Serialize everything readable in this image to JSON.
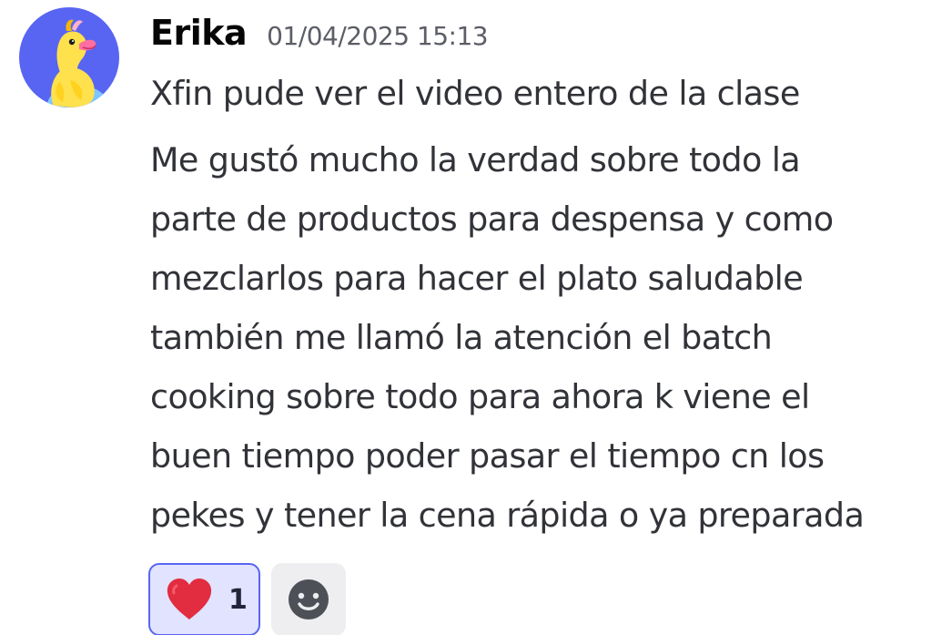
{
  "message": {
    "author": "Erika",
    "timestamp": "01/04/2025 15:13",
    "first_line": "Xfin pude ver el video entero de la clase",
    "body_lines": [
      "Me gustó mucho la verdad sobre todo la",
      "parte de productos para despensa y como",
      "mezclarlos para hacer el plato saludable",
      "también me llamó la atención el batch",
      "cooking sobre todo para ahora k viene el",
      "buen tiempo poder pasar el tiempo cn los",
      "pekes y tener la cena rápida o ya preparada"
    ]
  },
  "avatar": {
    "icon": "yellow-duck-avatar-icon",
    "background": "#5865f2"
  },
  "reactions": [
    {
      "emoji_icon": "red-heart-icon",
      "count": "1",
      "selected": true
    }
  ],
  "add_reaction": {
    "icon": "smiley-add-reaction-icon"
  },
  "colors": {
    "accent": "#5865f2",
    "reaction_bg": "#e1e3ff",
    "heart": "#e12d3f",
    "text": "#313338",
    "muted": "#5c5e66"
  }
}
